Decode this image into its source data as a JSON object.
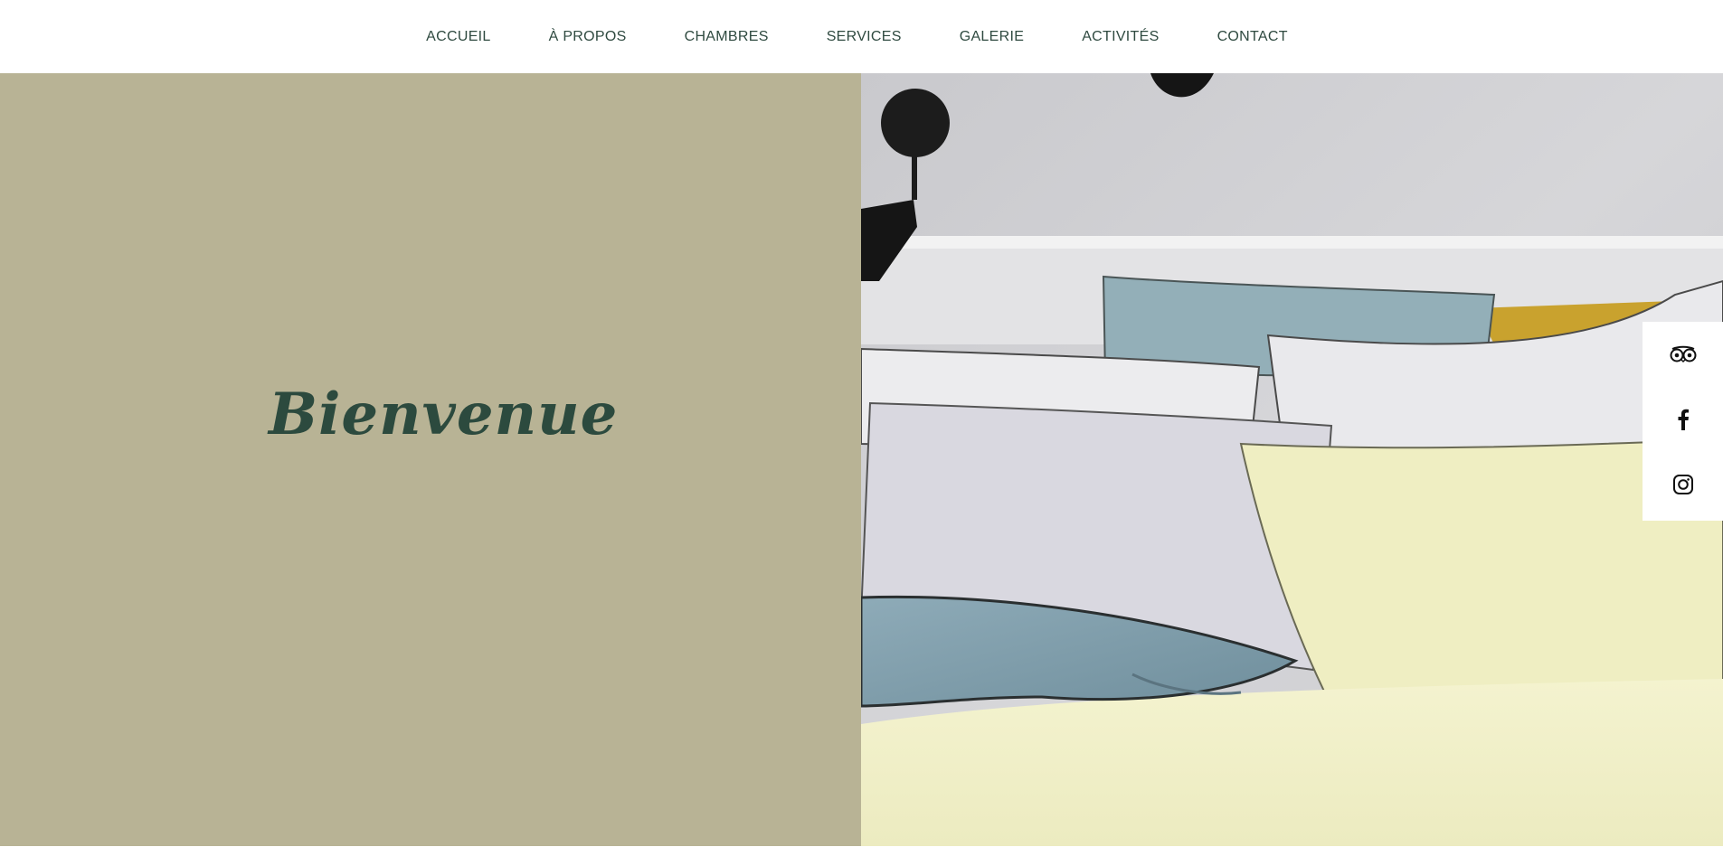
{
  "nav": {
    "items": [
      {
        "label": "ACCUEIL"
      },
      {
        "label": "À PROPOS"
      },
      {
        "label": "CHAMBRES"
      },
      {
        "label": "SERVICES"
      },
      {
        "label": "GALERIE"
      },
      {
        "label": "ACTIVITÉS"
      },
      {
        "label": "CONTACT"
      }
    ]
  },
  "hero": {
    "welcome_text": "Bienvenue",
    "image_subject": "bed with pastel pillows against grey wall"
  },
  "social": {
    "items": [
      {
        "icon": "tripadvisor-icon"
      },
      {
        "icon": "facebook-icon"
      },
      {
        "icon": "instagram-icon"
      }
    ]
  },
  "colors": {
    "nav_text": "#2f4a40",
    "hero_left_bg": "#b8b395",
    "welcome_text": "#2c4a3e",
    "pillow_blue": "#7f9fad",
    "pillow_yellow": "#f0efc2",
    "pillow_grey": "#dcdbe2"
  }
}
